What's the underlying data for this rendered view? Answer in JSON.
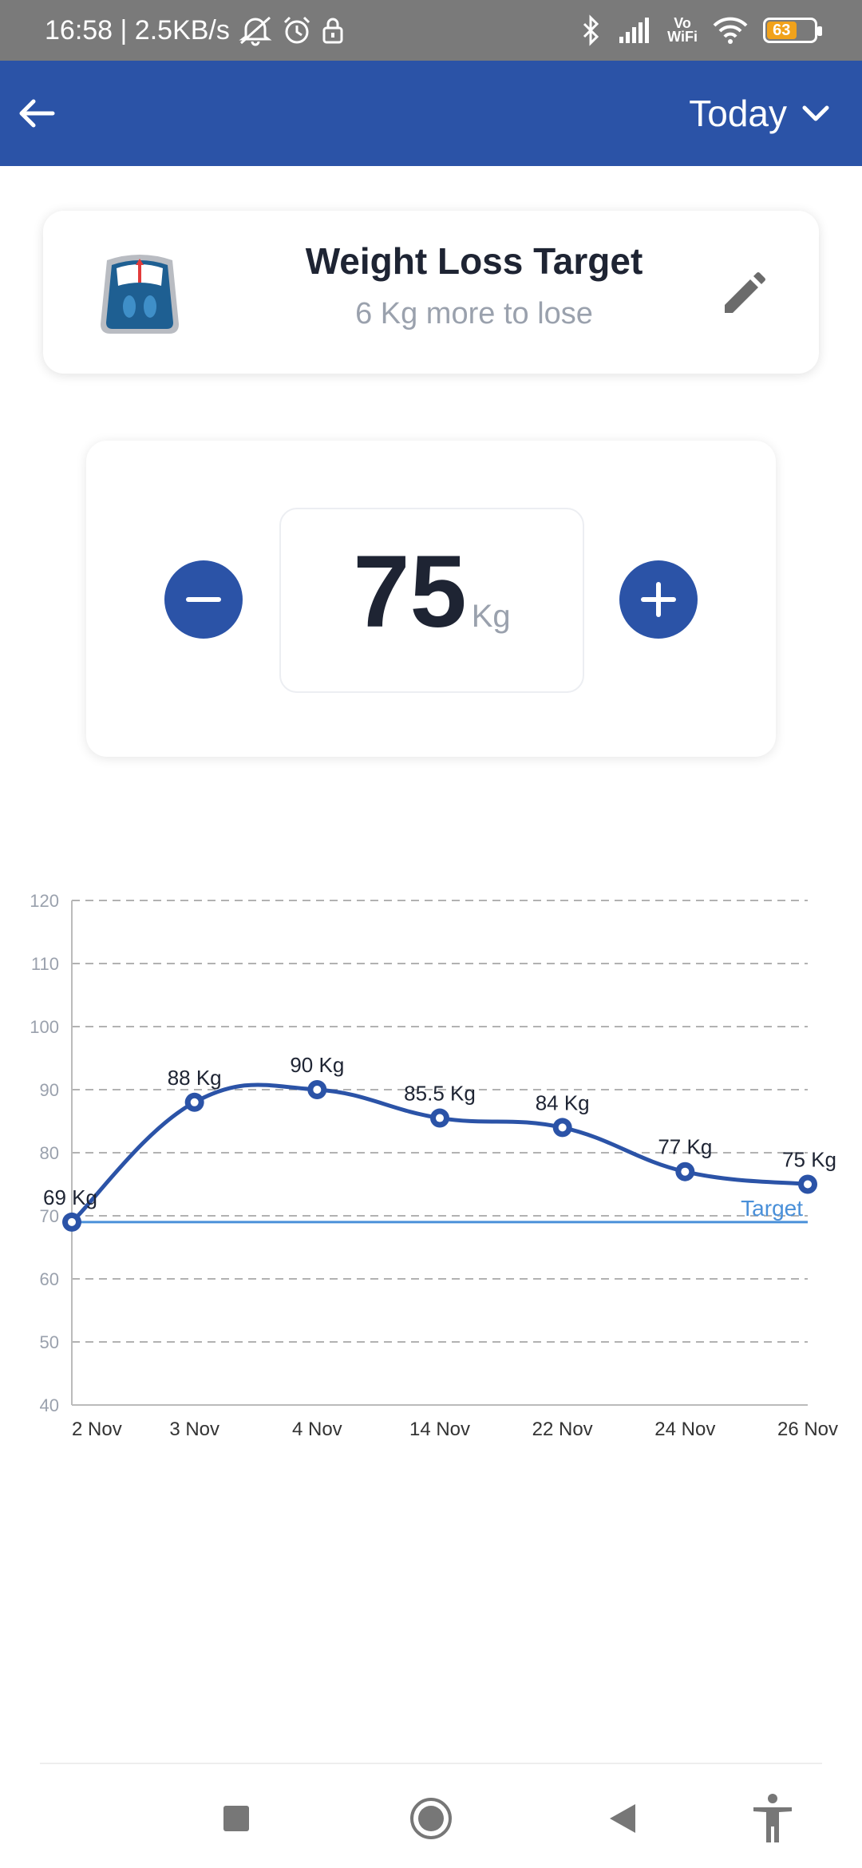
{
  "status_bar": {
    "time_speed": "16:58 | 2.5KB/s",
    "vowifi_top": "Vo",
    "vowifi_bottom": "WiFi",
    "battery_level": "63",
    "battery_fraction": 0.63,
    "battery_color": "#f1a21b",
    "icons": [
      "mute-icon",
      "alarm-icon",
      "lock-icon",
      "bluetooth-icon",
      "signal-icon",
      "wifi-icon",
      "battery-icon"
    ]
  },
  "app_bar": {
    "background": "#2b53a7",
    "period_label": "Today",
    "back_icon": "back-arrow-icon",
    "dropdown_icon": "chevron-down-icon"
  },
  "target_card": {
    "title": "Weight Loss Target",
    "subtitle": "6 Kg more to lose",
    "icon": "scale-icon",
    "edit_icon": "pencil-icon"
  },
  "weight_input": {
    "value": "75",
    "unit": "Kg",
    "decrement_icon": "minus-icon",
    "increment_icon": "plus-icon"
  },
  "chart_data": {
    "type": "line",
    "categories": [
      "2 Nov",
      "3 Nov",
      "4 Nov",
      "14 Nov",
      "22 Nov",
      "24 Nov",
      "26 Nov"
    ],
    "series": [
      {
        "values": [
          69,
          88,
          90,
          85.5,
          84,
          77,
          75
        ],
        "labels": [
          "69 Kg",
          "88 Kg",
          "90 Kg",
          "85.5 Kg",
          "84 Kg",
          "77 Kg",
          "75 Kg"
        ],
        "color": "#2b53a7"
      }
    ],
    "target": {
      "value": 69,
      "label": "Target",
      "color": "#4a90d9"
    },
    "ylim": [
      40,
      120
    ],
    "yticks": [
      40,
      50,
      60,
      70,
      80,
      90,
      100,
      110,
      120
    ],
    "grid": true,
    "legend": "none"
  },
  "nav_bar": {
    "buttons": [
      "recents-icon",
      "home-icon",
      "back-icon",
      "accessibility-icon"
    ]
  }
}
